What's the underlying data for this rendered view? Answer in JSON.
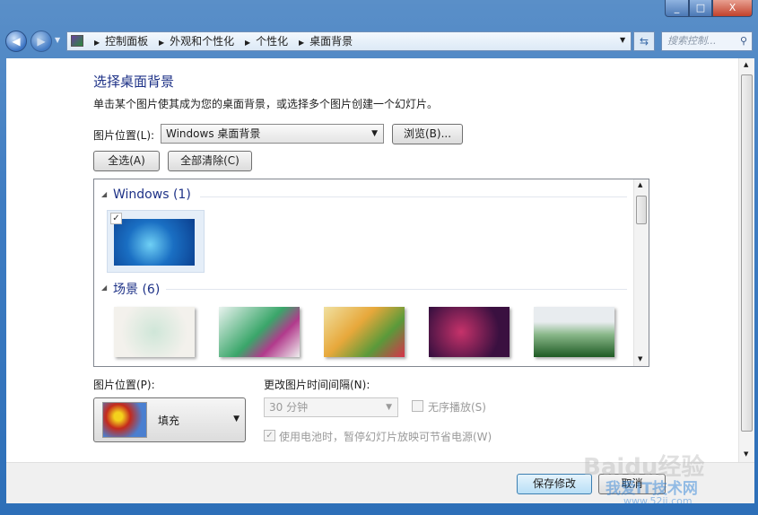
{
  "window_controls": {
    "minimize": "_",
    "maximize": "□",
    "close": "X"
  },
  "address_bar": {
    "breadcrumbs": [
      "控制面板",
      "外观和个性化",
      "个性化",
      "桌面背景"
    ]
  },
  "search": {
    "placeholder": "搜索控制..."
  },
  "main": {
    "title": "选择桌面背景",
    "description": "单击某个图片使其成为您的桌面背景，或选择多个图片创建一个幻灯片。",
    "location_label": "图片位置(L):",
    "location_value": "Windows 桌面背景",
    "browse_button": "浏览(B)...",
    "select_all_button": "全选(A)",
    "clear_all_button": "全部清除(C)",
    "groups": [
      {
        "name": "Windows (1)",
        "items": [
          {
            "checked": true
          }
        ]
      },
      {
        "name": "场景 (6)",
        "items": [
          {},
          {},
          {},
          {},
          {}
        ]
      }
    ],
    "position_label": "图片位置(P):",
    "position_value": "填充",
    "interval_label": "更改图片时间间隔(N):",
    "interval_value": "30 分钟",
    "shuffle_label": "无序播放(S)",
    "battery_label": "使用电池时，暂停幻灯片放映可节省电源(W)"
  },
  "footer": {
    "save_button": "保存修改",
    "cancel_button": "取消"
  },
  "watermark": {
    "baidu": "Baidu经验",
    "site": "我爱IT技术网",
    "url": "www.52ij.com"
  }
}
